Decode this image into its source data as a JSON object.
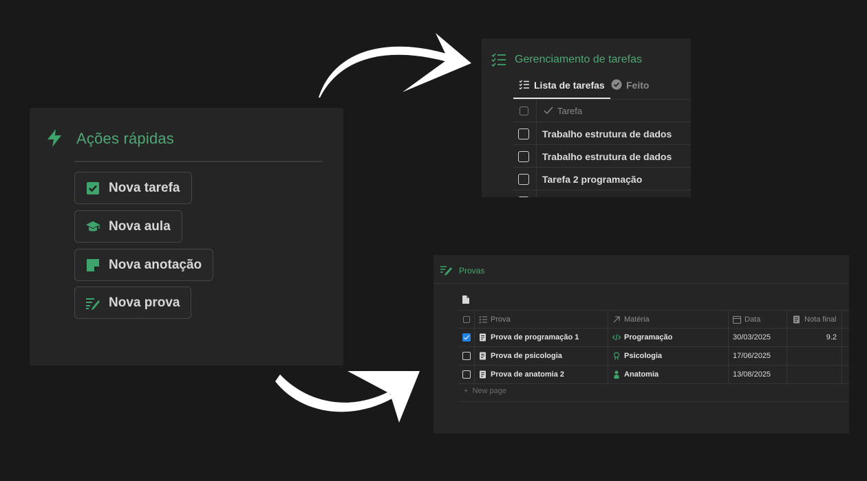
{
  "quick_actions": {
    "title": "Ações rápidas",
    "title_icon": "lightning-bolt-icon",
    "buttons": [
      {
        "label": "Nova tarefa",
        "icon": "checkbox-checked-icon"
      },
      {
        "label": "Nova aula",
        "icon": "graduation-cap-icon"
      },
      {
        "label": "Nova anotação",
        "icon": "sticky-note-icon"
      },
      {
        "label": "Nova prova",
        "icon": "list-pencil-icon"
      }
    ]
  },
  "task_manager": {
    "title": "Gerenciamento de tarefas",
    "title_icon": "checklist-icon",
    "tabs": [
      {
        "label": "Lista de tarefas",
        "icon": "checklist-icon",
        "active": true
      },
      {
        "label": "Feito",
        "icon": "check-circle-icon",
        "active": false
      }
    ],
    "column_header": "Tarefa",
    "rows": [
      {
        "title": "Trabalho estrutura de dados",
        "done": false
      },
      {
        "title": "Trabalho estrutura de dados",
        "done": false
      },
      {
        "title": "Tarefa 2 programação",
        "done": false
      }
    ]
  },
  "provas": {
    "title": "Provas",
    "title_icon": "list-pencil-icon",
    "columns": [
      "Prova",
      "Matéria",
      "Data",
      "Nota final"
    ],
    "rows": [
      {
        "checked": true,
        "prova": "Prova de programação 1",
        "materia": "Programação",
        "materia_icon": "code-icon",
        "data": "30/03/2025",
        "nota": "9.2"
      },
      {
        "checked": false,
        "prova": "Prova de psicologia",
        "materia": "Psicologia",
        "materia_icon": "brain-head-icon",
        "data": "17/06/2025",
        "nota": ""
      },
      {
        "checked": false,
        "prova": "Prova de anatomia 2",
        "materia": "Anatomia",
        "materia_icon": "body-icon",
        "data": "13/08/2025",
        "nota": ""
      }
    ],
    "new_page_label": "New page"
  },
  "colors": {
    "background": "#191919",
    "panel": "#252525",
    "accent_green": "#4fa774",
    "checkbox_blue": "#2383e2"
  }
}
